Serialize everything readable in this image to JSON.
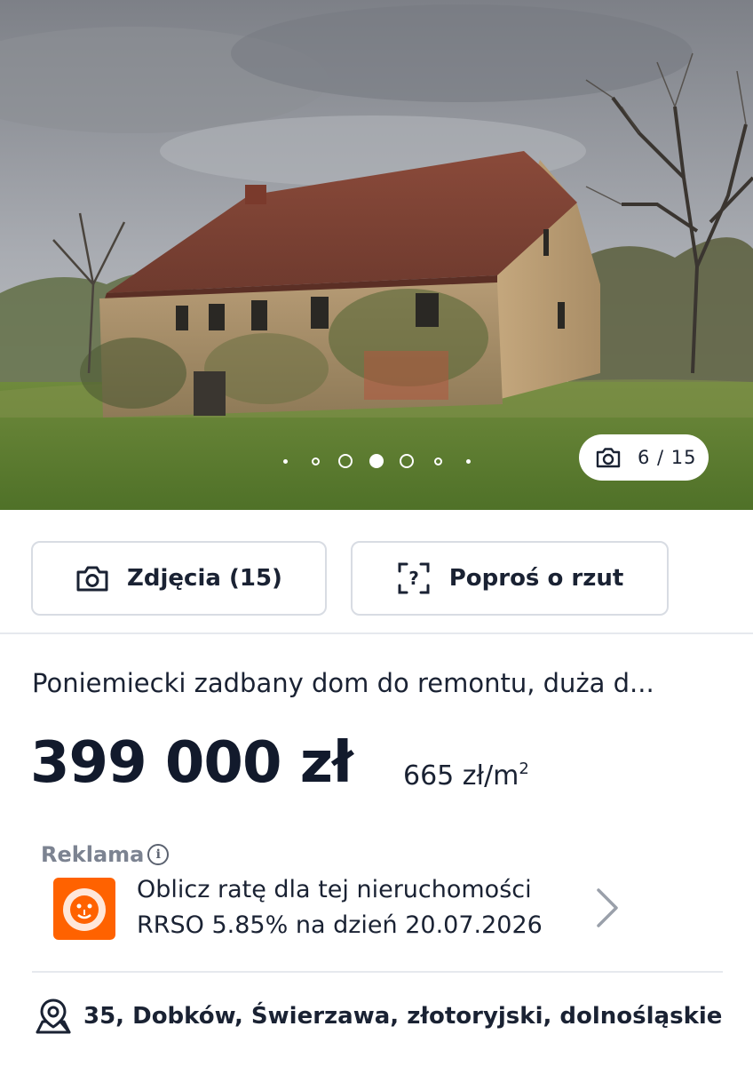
{
  "gallery": {
    "counter": "6 / 15",
    "active_dot": 3,
    "dot_count": 7,
    "icons": {
      "counter": "camera-icon"
    }
  },
  "actions": {
    "photos_label": "Zdjęcia (15)",
    "plan_label": "Poproś o rzut",
    "icons": {
      "photos": "camera-icon",
      "plan": "floor-plan-request-icon"
    }
  },
  "listing": {
    "title": "Poniemiecki zadbany dom do remontu, duża d...",
    "price": "399 000 zł",
    "price_per_m2": "665 zł/m",
    "price_per_m2_unit_sup": "2"
  },
  "ad": {
    "label": "Reklama",
    "info_glyph": "i",
    "line1": "Oblicz ratę dla tej nieruchomości",
    "line2": "RRSO 5.85% na dzień 20.07.2026",
    "logo": "lion-bank-logo",
    "accent_color": "#ff6200"
  },
  "location": {
    "address": "35, Dobków, Świerzawa, złotoryjski, dolnośląskie",
    "icon": "map-pin-icon"
  },
  "colors": {
    "text_primary": "#1a2233",
    "border": "#d8dce3",
    "muted": "#7c8391"
  }
}
